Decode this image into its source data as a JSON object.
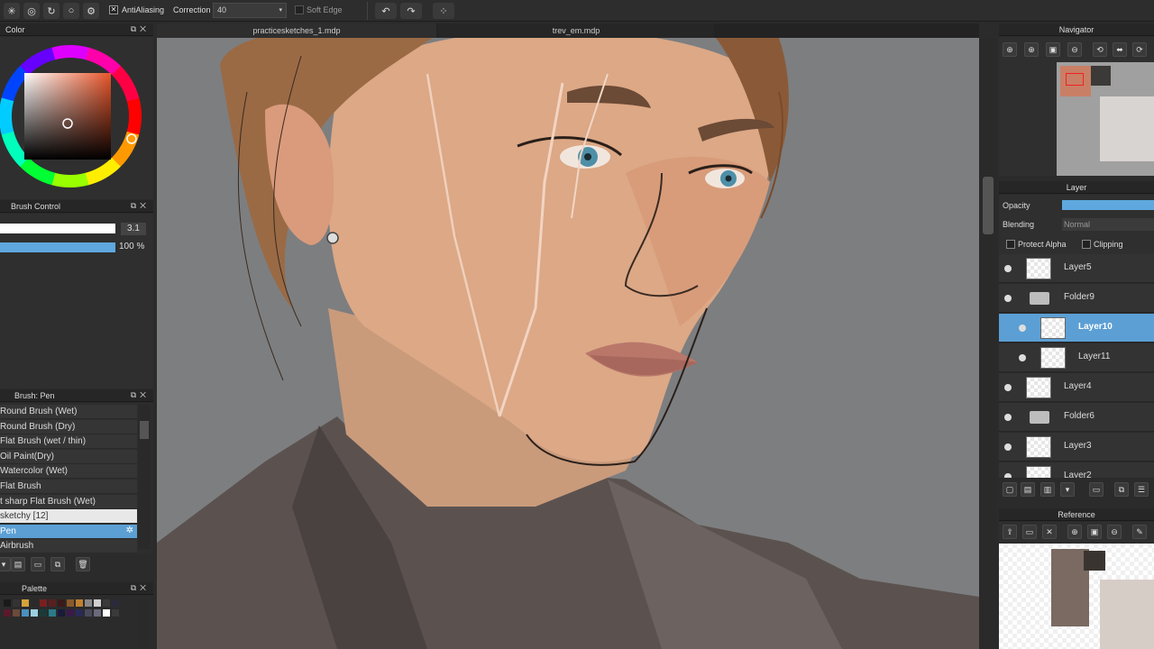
{
  "toolbar": {
    "antialiasing_label": "AntiAliasing",
    "correction_label": "Correction",
    "correction_value": "40",
    "soft_edge_label": "Soft Edge"
  },
  "tabs": [
    "practicesketches_1.mdp",
    "trev_em.mdp"
  ],
  "color_panel": {
    "title": "Color"
  },
  "brush_control": {
    "title": "Brush Control",
    "size_value": "3.1",
    "opacity_value": "100 %"
  },
  "brush_panel": {
    "title": "Brush: Pen",
    "items": [
      "Round Brush (Wet)",
      "Round Brush (Dry)",
      "Flat Brush (wet / thin)",
      "Oil Paint(Dry)",
      "Watercolor (Wet)",
      "Flat Brush",
      "t sharp Flat Brush (Wet)",
      "sketchy [12]",
      "Pen",
      "Airbrush"
    ],
    "selected_index": 8
  },
  "palette_panel": {
    "title": "Palette",
    "colors": [
      "#1a1a1a",
      "#333333",
      "#d4a33a",
      "#2a2a2a",
      "#7a1f1f",
      "#5a1f1f",
      "#3a1a1a",
      "#8a5a2a",
      "#c08030",
      "#888888",
      "#d0d0d0",
      "#3a3a3a",
      "#2a2a3a",
      "#5a1a2a",
      "#6a4a3a",
      "#4a90c0",
      "#9ad0e0",
      "#1a3a3a",
      "#2a7a8a",
      "#1a1a3a",
      "#3a1a4a",
      "#2a2a5a",
      "#4a4a5a",
      "#6a6a7a",
      "#ffffff",
      "#3a3a3a"
    ]
  },
  "navigator": {
    "title": "Navigator"
  },
  "layer_panel": {
    "title": "Layer",
    "opacity_label": "Opacity",
    "blending_label": "Blending",
    "blending_value": "Normal",
    "protect_alpha_label": "Protect Alpha",
    "clipping_label": "Clipping",
    "layers": [
      {
        "name": "Layer5",
        "type": "layer",
        "indent": 0,
        "selected": false
      },
      {
        "name": "Folder9",
        "type": "folder",
        "indent": 0,
        "selected": false
      },
      {
        "name": "Layer10",
        "type": "layer",
        "indent": 1,
        "selected": true
      },
      {
        "name": "Layer11",
        "type": "layer",
        "indent": 1,
        "selected": false
      },
      {
        "name": "Layer4",
        "type": "layer",
        "indent": 0,
        "selected": false
      },
      {
        "name": "Folder6",
        "type": "folder",
        "indent": 0,
        "selected": false
      },
      {
        "name": "Layer3",
        "type": "layer",
        "indent": 0,
        "selected": false
      },
      {
        "name": "Layer2",
        "type": "layer",
        "indent": 0,
        "selected": false
      }
    ]
  },
  "reference_panel": {
    "title": "Reference"
  },
  "colors": {
    "accent": "#5b9fd4",
    "canvas_bg": "#7d7e80",
    "panel_bg": "#2f2f2f"
  }
}
